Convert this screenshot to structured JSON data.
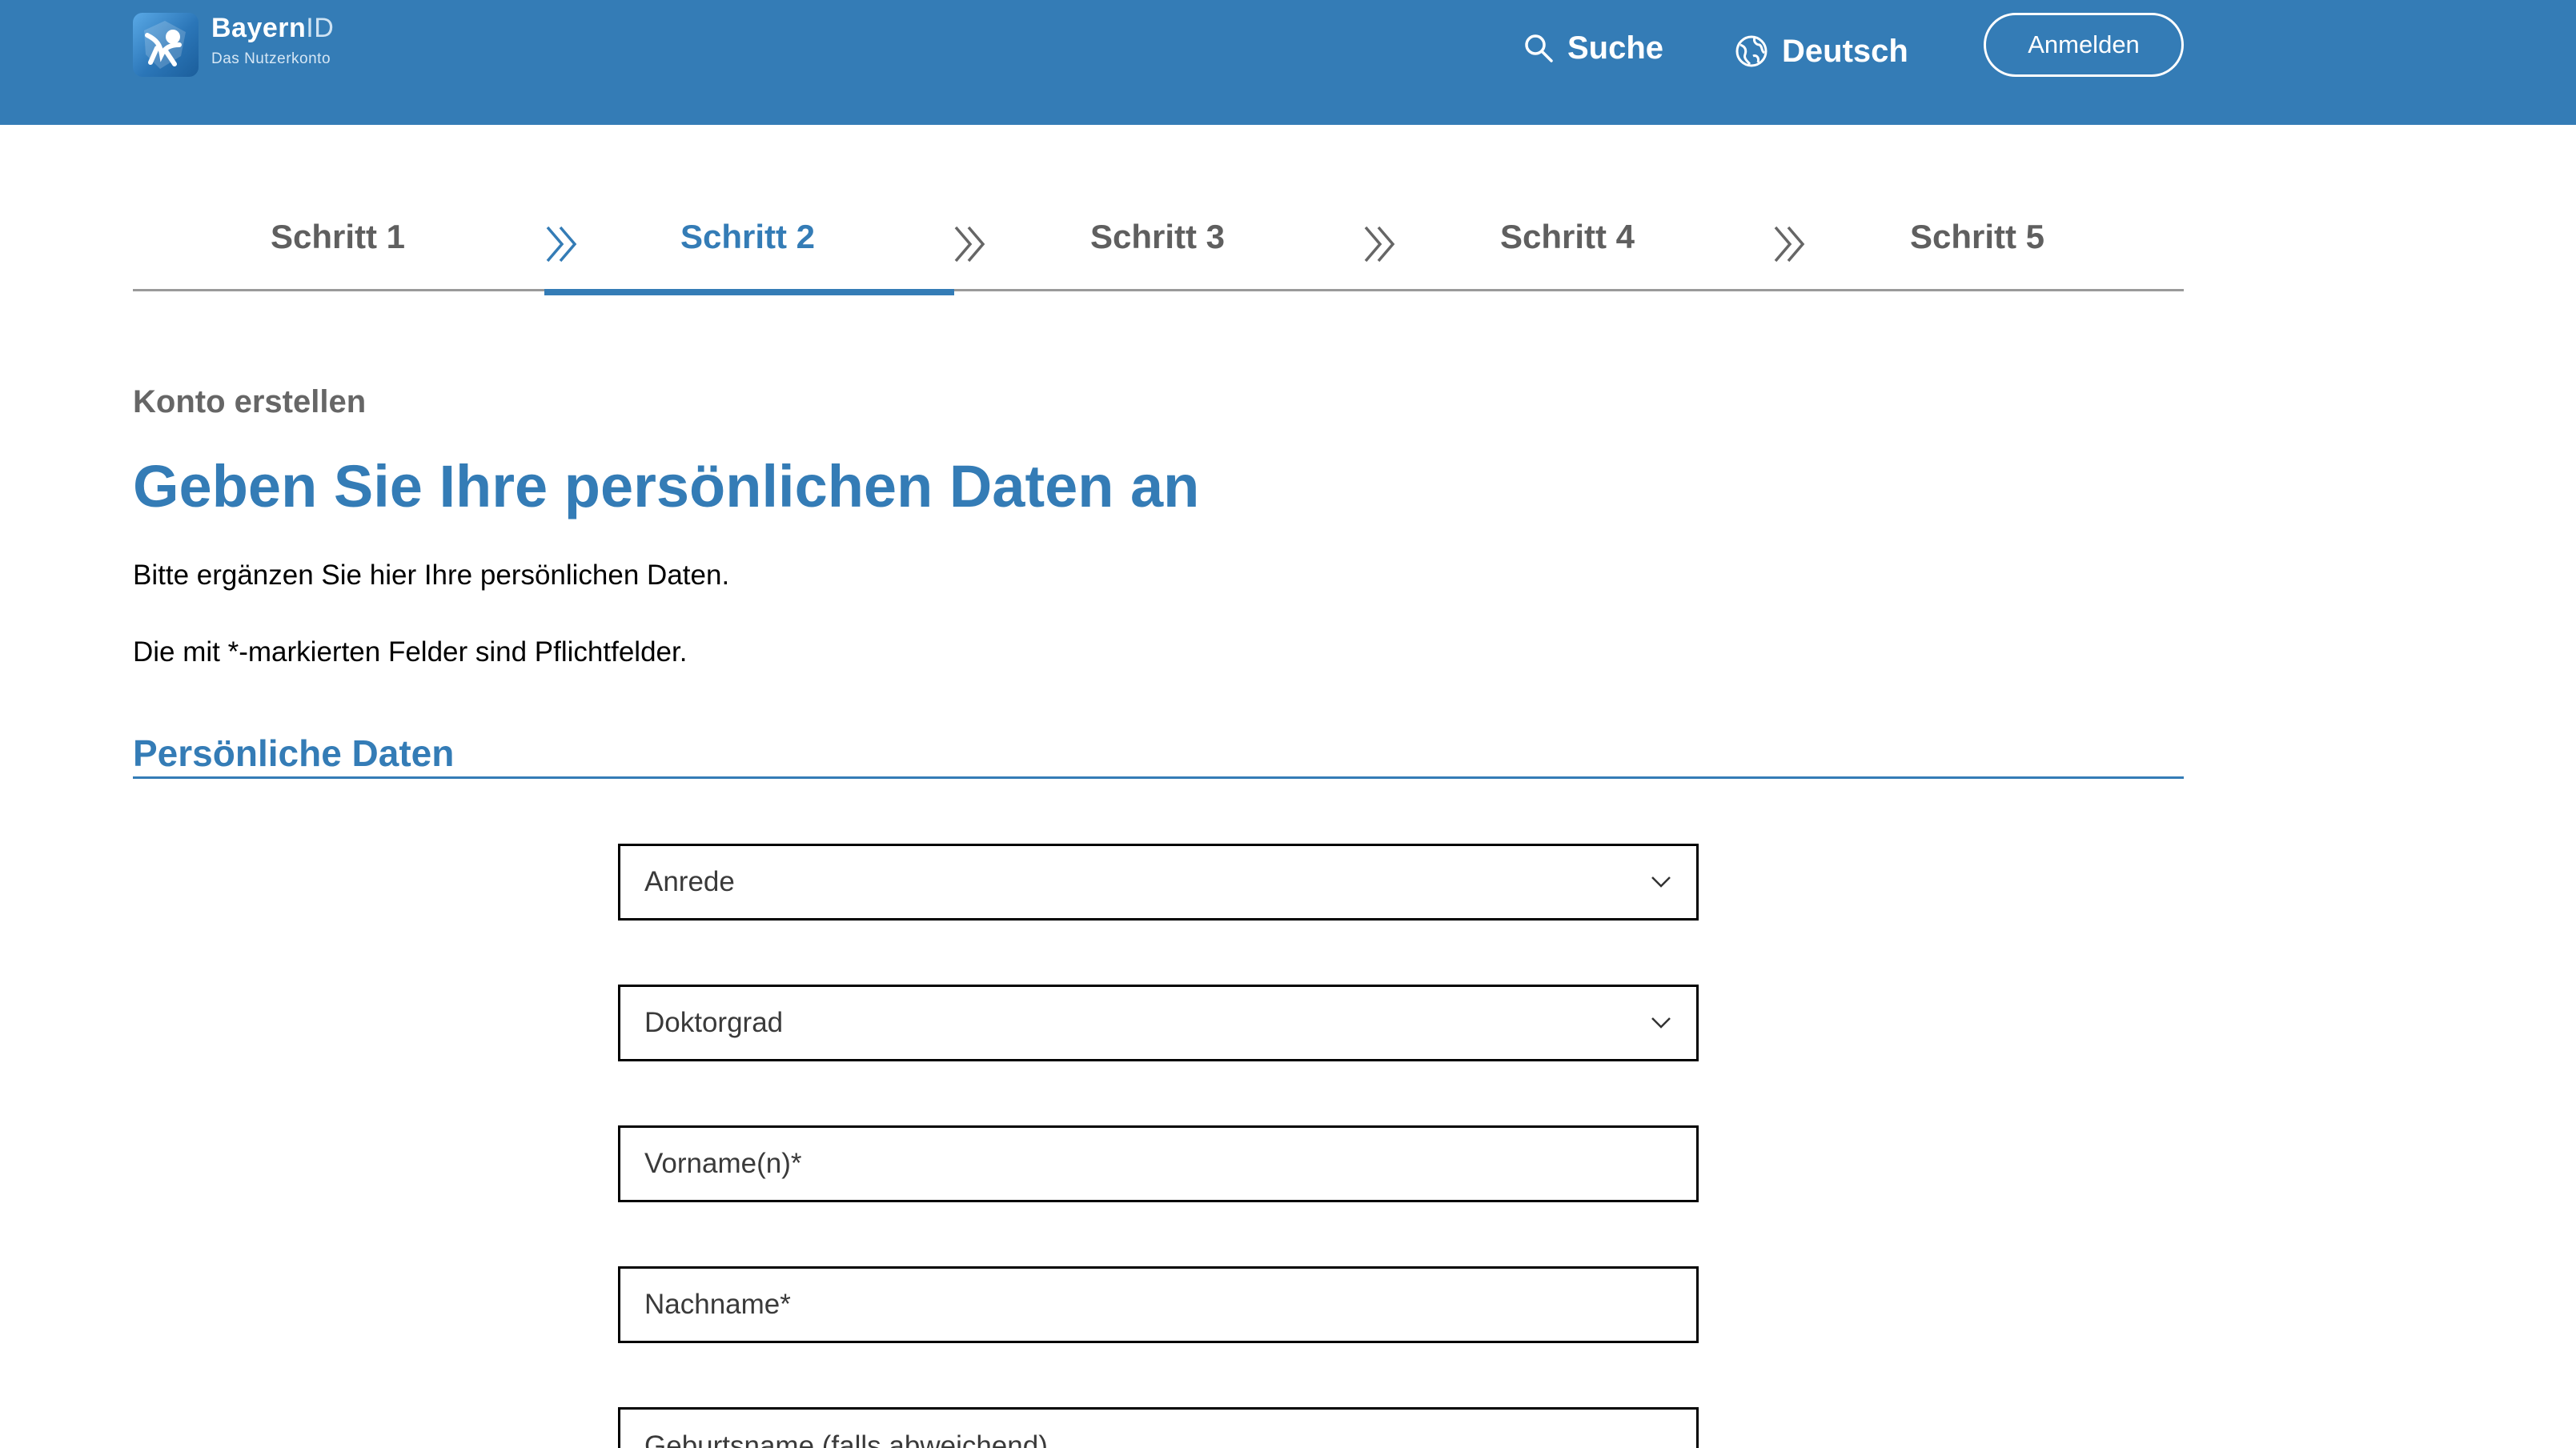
{
  "header": {
    "brand_name": "Bayern",
    "brand_name_suffix": "ID",
    "brand_subtitle": "Das Nutzerkonto",
    "search_label": "Suche",
    "language_label": "Deutsch",
    "login_label": "Anmelden",
    "background_color": "#347cb6"
  },
  "stepper": {
    "steps": [
      {
        "label": "Schritt 1",
        "active": false
      },
      {
        "label": "Schritt 2",
        "active": true
      },
      {
        "label": "Schritt 3",
        "active": false
      },
      {
        "label": "Schritt 4",
        "active": false
      },
      {
        "label": "Schritt 5",
        "active": false
      }
    ],
    "active_color": "#347cb6"
  },
  "content": {
    "overline": "Konto erstellen",
    "title": "Geben Sie Ihre persönlichen Daten an",
    "intro": "Bitte ergänzen Sie hier Ihre persönlichen Daten.",
    "required_note": "Die mit *-markierten Felder sind Pflichtfelder.",
    "section_title": "Persönliche Daten"
  },
  "form": {
    "salutation_placeholder": "Anrede",
    "doctorate_placeholder": "Doktorgrad",
    "first_name_placeholder": "Vorname(n)*",
    "last_name_placeholder": "Nachname*",
    "birth_name_placeholder": "Geburtsname (falls abweichend)"
  }
}
